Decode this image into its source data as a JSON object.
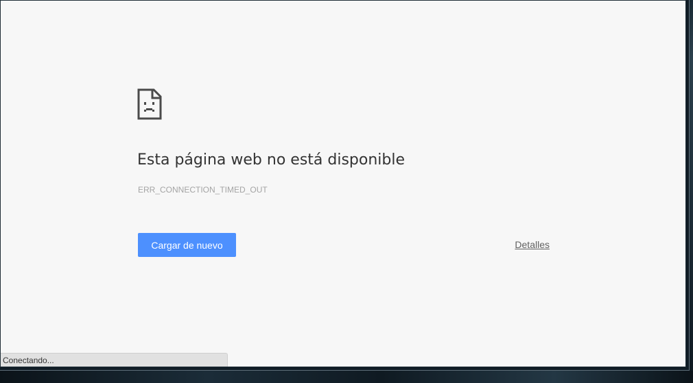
{
  "error_page": {
    "icon": "sad-page-icon",
    "title": "Esta página web no está disponible",
    "error_code": "ERR_CONNECTION_TIMED_OUT",
    "reload_button_label": "Cargar de nuevo",
    "details_link_label": "Detalles",
    "accent_color": "#4d90fe"
  },
  "status_bar": {
    "text": "Conectando..."
  }
}
